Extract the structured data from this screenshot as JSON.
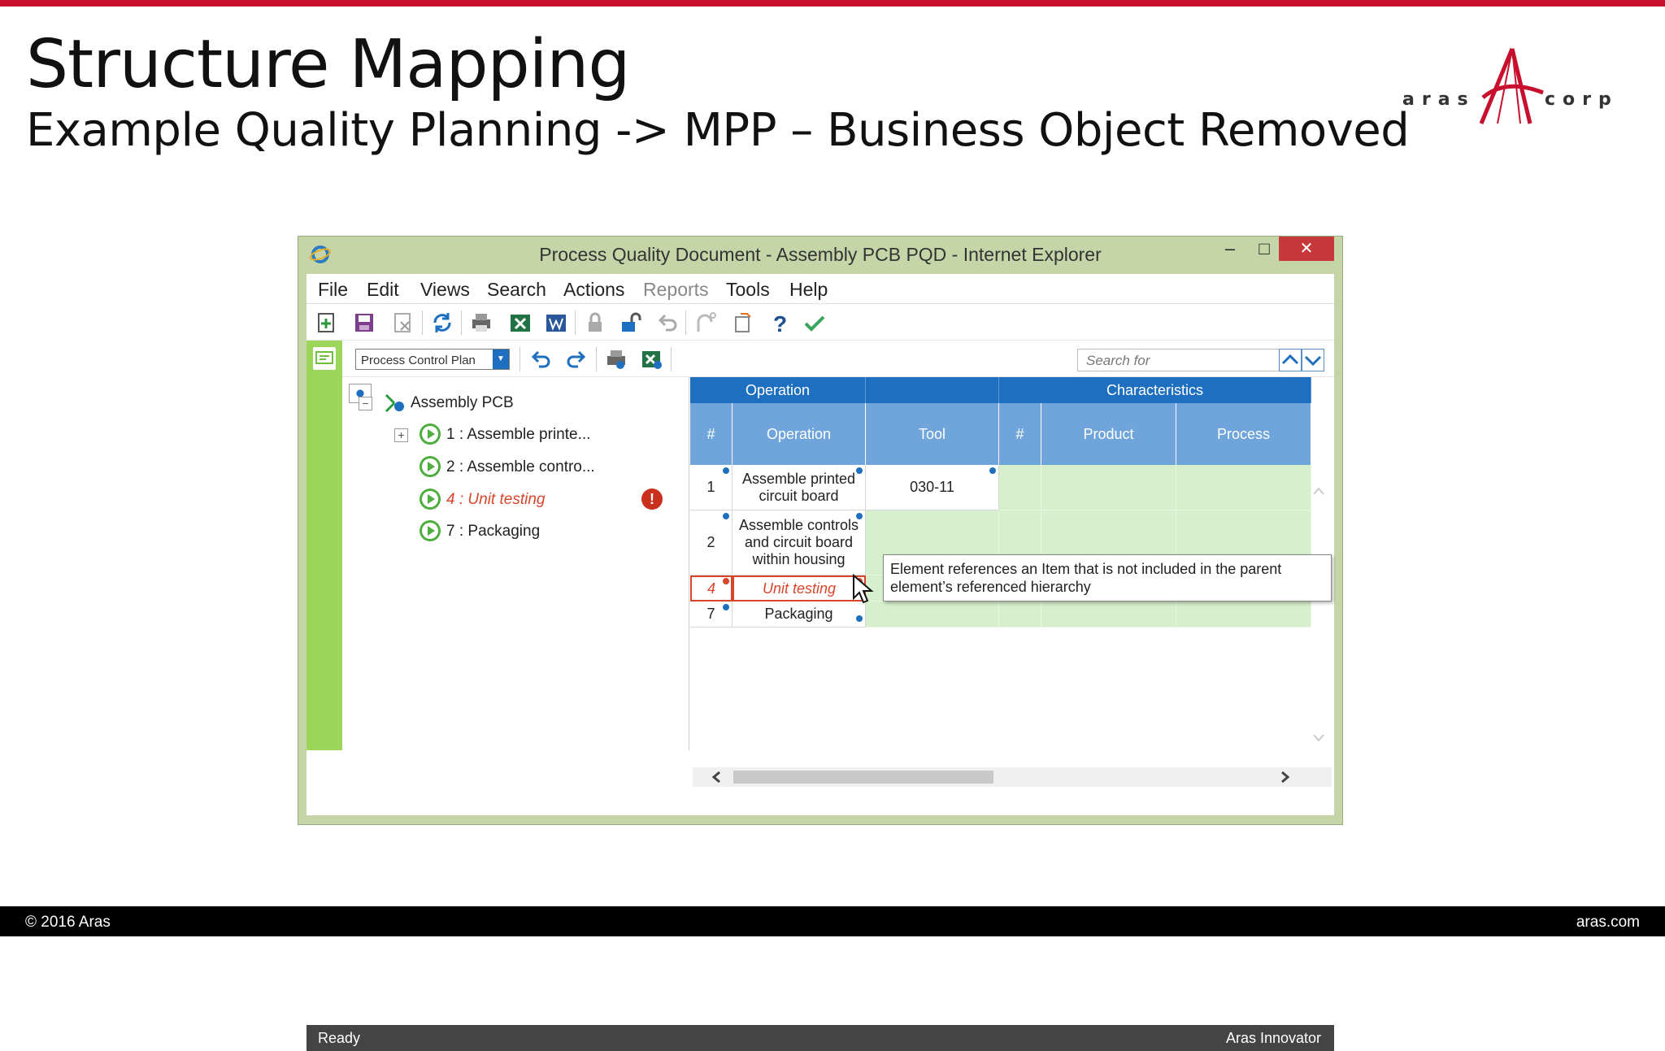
{
  "slide": {
    "title": "Structure Mapping",
    "subtitle": "Example Quality Planning -> MPP – Business Object Removed",
    "logo_left": "aras",
    "logo_right": "corp",
    "footer_left": "© 2016 Aras",
    "footer_right": "aras.com",
    "accent_color": "#c8102e"
  },
  "window": {
    "title": "Process Quality Document - Assembly PCB PQD - Internet Explorer",
    "minimize": "–",
    "maximize": "□",
    "close": "✕"
  },
  "menu": [
    "File",
    "Edit",
    "Views",
    "Search",
    "Actions",
    "Reports",
    "Tools",
    "Help"
  ],
  "toolbar": {
    "view_select": "Process Control Plan",
    "search_placeholder": "Search for"
  },
  "tree": {
    "root": "Assembly PCB",
    "items": [
      {
        "label": "1 : Assemble printe...",
        "error": false
      },
      {
        "label": "2 : Assemble contro...",
        "error": false
      },
      {
        "label": "4 : Unit testing",
        "error": true
      },
      {
        "label": "7 : Packaging",
        "error": false
      }
    ],
    "error_icon": "!"
  },
  "grid": {
    "group_headers": [
      "Operation",
      "",
      "Characteristics"
    ],
    "columns": [
      "#",
      "Operation",
      "Tool",
      "#",
      "Product",
      "Process"
    ],
    "rows": [
      {
        "num": "1",
        "operation": "Assemble printed circuit board",
        "tool": "030-11"
      },
      {
        "num": "2",
        "operation": "Assemble controls and circuit board within housing",
        "tool": ""
      },
      {
        "num": "4",
        "operation": "Unit testing",
        "tool": ""
      },
      {
        "num": "7",
        "operation": "Packaging",
        "tool": ""
      }
    ]
  },
  "tooltip": "Element references an Item that is not included in the parent element’s referenced hierarchy",
  "status": {
    "left": "Ready",
    "right": "Aras Innovator"
  },
  "colors": {
    "header_blue": "#1e6fbf",
    "subheader_blue": "#6fa5db",
    "green_strip": "#9bd65a",
    "error_red": "#d9452b"
  }
}
